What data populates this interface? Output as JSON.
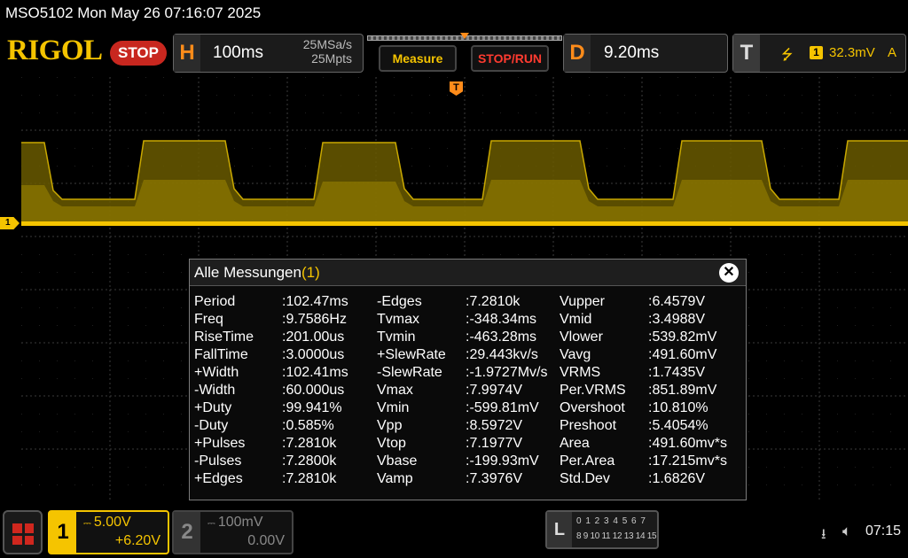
{
  "title_line": "MSO5102  Mon May 26 07:16:07 2025",
  "brand": "RIGOL",
  "run_state": "STOP",
  "horizontal": {
    "letter": "H",
    "timebase": "100ms",
    "sample_rate": "25MSa/s",
    "memory_depth": "25Mpts"
  },
  "buttons": {
    "measure": "Measure",
    "stop_run": "STOP/RUN"
  },
  "delay": {
    "letter": "D",
    "value": "9.20ms"
  },
  "trigger": {
    "letter": "T",
    "edge_symbol": "⭍",
    "channel": "1",
    "level": "32.3mV",
    "mode": "A"
  },
  "markers": {
    "trigger_pos": "T",
    "ch1": "1"
  },
  "measurements": {
    "title": "Alle Messungen",
    "count": "(1)",
    "close": "✕",
    "col1": [
      {
        "label": "Period",
        "value": ":102.47ms"
      },
      {
        "label": "Freq",
        "value": ":9.7586Hz"
      },
      {
        "label": "RiseTime",
        "value": ":201.00us"
      },
      {
        "label": "FallTime",
        "value": ":3.0000us"
      },
      {
        "label": "+Width",
        "value": ":102.41ms"
      },
      {
        "label": "-Width",
        "value": ":60.000us"
      },
      {
        "label": "+Duty",
        "value": ":99.941%"
      },
      {
        "label": "-Duty",
        "value": ":0.585%"
      },
      {
        "label": "+Pulses",
        "value": ":7.2810k"
      },
      {
        "label": "-Pulses",
        "value": ":7.2800k"
      },
      {
        "label": "+Edges",
        "value": ":7.2810k"
      }
    ],
    "col2": [
      {
        "label": "-Edges",
        "value": ":7.2810k"
      },
      {
        "label": "Tvmax",
        "value": ":-348.34ms"
      },
      {
        "label": "Tvmin",
        "value": ":-463.28ms"
      },
      {
        "label": "+SlewRate",
        "value": ":29.443kv/s"
      },
      {
        "label": "-SlewRate",
        "value": ":-1.9727Mv/s"
      },
      {
        "label": "Vmax",
        "value": ":7.9974V"
      },
      {
        "label": "Vmin",
        "value": ":-599.81mV"
      },
      {
        "label": "Vpp",
        "value": ":8.5972V"
      },
      {
        "label": "Vtop",
        "value": ":7.1977V"
      },
      {
        "label": "Vbase",
        "value": ":-199.93mV"
      },
      {
        "label": "Vamp",
        "value": ":7.3976V"
      }
    ],
    "col3": [
      {
        "label": "Vupper",
        "value": ":6.4579V"
      },
      {
        "label": "Vmid",
        "value": ":3.4988V"
      },
      {
        "label": "Vlower",
        "value": ":539.82mV"
      },
      {
        "label": "Vavg",
        "value": ":491.60mV"
      },
      {
        "label": "VRMS",
        "value": ":1.7435V"
      },
      {
        "label": "Per.VRMS",
        "value": ":851.89mV"
      },
      {
        "label": "Overshoot",
        "value": ":10.810%"
      },
      {
        "label": "Preshoot",
        "value": ":5.4054%"
      },
      {
        "label": "Area",
        "value": ":491.60mv*s"
      },
      {
        "label": "Per.Area",
        "value": ":17.215mv*s"
      },
      {
        "label": "Std.Dev",
        "value": ":1.6826V"
      }
    ]
  },
  "channels": {
    "ch1": {
      "number": "1",
      "scale": "5.00V",
      "offset": "+6.20V",
      "coupling_icon": "dc-coupling-icon"
    },
    "ch2": {
      "number": "2",
      "scale": "100mV",
      "offset": "0.00V",
      "coupling_icon": "dc-coupling-icon"
    }
  },
  "logic": {
    "letter": "L",
    "row1": "0 1 2 3  4 5 6 7",
    "row2": "8 9 10 11 12 13 14 15"
  },
  "status": {
    "usb": "⭳",
    "speaker": "🔈︎",
    "time": "07:15"
  },
  "colors": {
    "ch1": "#f5c400",
    "accent": "#ff8c1a",
    "stop": "#c8271f",
    "grid": "#3a3a3a"
  }
}
